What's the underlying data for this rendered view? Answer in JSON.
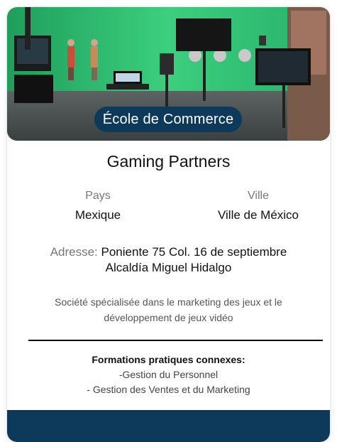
{
  "photo": {
    "icon": "green-screen-studio-photo"
  },
  "category": "École de Commerce",
  "company": {
    "name": "Gaming Partners"
  },
  "location": {
    "country_label": "Pays",
    "country_value": "Mexique",
    "city_label": "Ville",
    "city_value": "Ville de México"
  },
  "address": {
    "label": "Adresse:",
    "line1": "Poniente 75 Col. 16 de septiembre",
    "line2": "Alcaldía Miguel Hidalgo"
  },
  "description": "Société spécialisée dans le marketing des jeux et le développement de jeux vidéo",
  "formations": {
    "title": "Formations pratiques connexes:",
    "items": [
      "-Gestion du Personnel",
      "- Gestion des Ventes et du Marketing"
    ]
  },
  "colors": {
    "navy": "#0d3a5a",
    "green_screen": "#2fc06e"
  }
}
